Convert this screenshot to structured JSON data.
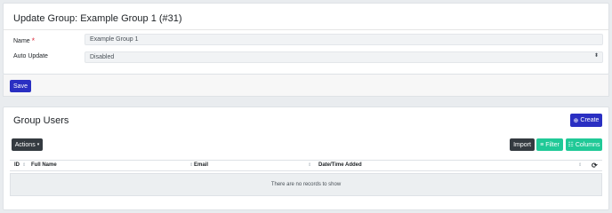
{
  "update_card": {
    "title": "Update Group: Example Group 1 (#31)",
    "fields": {
      "name": {
        "label": "Name",
        "required_mark": "*",
        "value": "Example Group 1"
      },
      "auto_update": {
        "label": "Auto Update",
        "value": "Disabled",
        "arrow": "⬍"
      }
    },
    "save_label": "Save"
  },
  "users_card": {
    "title": "Group Users",
    "create_label": "Create",
    "create_icon": "⊕",
    "actions_label": "Actions",
    "actions_caret": "▾",
    "import_label": "Import",
    "filter_label": "Filter",
    "filter_icon": "≡",
    "columns_label": "Columns",
    "columns_icon": "☷",
    "table": {
      "columns": [
        "ID",
        "Full Name",
        "Email",
        "Date/Time Added"
      ],
      "sort_glyph": "⇕",
      "refresh_icon": "⟳",
      "empty_message": "There are no records to show"
    }
  },
  "colors": {
    "primary": "#2a2fc2",
    "success": "#20c997",
    "dark": "#343a40",
    "required": "#dc3545"
  }
}
